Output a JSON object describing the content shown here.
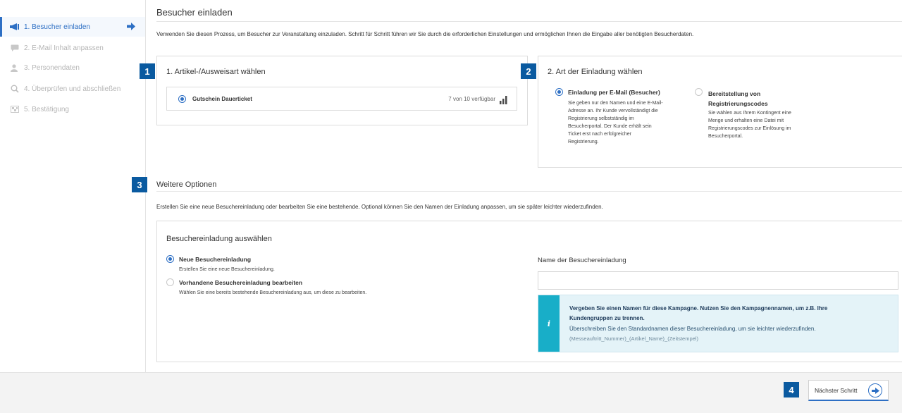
{
  "sidebar": {
    "items": [
      {
        "label": "1. Besucher einladen",
        "icon": "megaphone-icon",
        "active": true
      },
      {
        "label": "2. E-Mail Inhalt anpassen",
        "icon": "message-icon",
        "active": false
      },
      {
        "label": "3. Personendaten",
        "icon": "person-icon",
        "active": false
      },
      {
        "label": "4. Überprüfen und abschließen",
        "icon": "search-icon",
        "active": false
      },
      {
        "label": "5. Bestätigung",
        "icon": "flag-icon",
        "active": false
      }
    ]
  },
  "page": {
    "title": "Besucher einladen",
    "intro": "Verwenden Sie diesen Prozess, um Besucher zur Veranstaltung einzuladen. Schritt für Schritt führen wir Sie durch die erforderlichen Einstellungen und ermöglichen Ihnen die Eingabe aller benötigten Besucherdaten."
  },
  "step1": {
    "badge": "1",
    "title": "1. Artikel-/Ausweisart wählen",
    "article": {
      "label": "Gutschein Dauerticket",
      "availability": "7 von 10 verfügbar",
      "selected": true
    }
  },
  "step2": {
    "badge": "2",
    "title": "2. Art der Einladung wählen",
    "options": [
      {
        "title": "Einladung per E-Mail (Besucher)",
        "desc_lines": [
          "Sie geben nur den Namen und eine E-Mail-",
          "Adresse an. Ihr Kunde vervollständigt die",
          "Registrierung selbstständig im",
          "Besucherportal. Der Kunde erhält sein",
          "Ticket erst nach erfolgreicher",
          "Registrierung."
        ],
        "selected": true
      },
      {
        "title_lines": [
          "Bereitstellung von",
          "Registrierungscodes"
        ],
        "desc_lines": [
          "Sie wählen aus Ihrem Kontingent eine",
          "Menge und erhalten eine Datei mit",
          "Registrierungscodes zur Einlösung im",
          "Besucherportal."
        ],
        "selected": false
      }
    ]
  },
  "step3": {
    "badge": "3",
    "title": "Weitere Optionen",
    "desc": "Erstellen Sie eine neue Besuchereinladung oder bearbeiten Sie eine bestehende. Optional können Sie den Namen der Einladung anpassen, um sie später leichter wiederzufinden.",
    "panel_title": "Besuchereinladung auswählen",
    "options": [
      {
        "title": "Neue Besuchereinladung",
        "desc": "Erstellen Sie eine neue Besuchereinladung.",
        "selected": true
      },
      {
        "title": "Vorhandene Besuchereinladung bearbeiten",
        "desc": "Wählen Sie eine bereits bestehende Besuchereinladung aus, um diese zu bearbeiten.",
        "selected": false
      }
    ],
    "name_label": "Name der Besuchereinladung",
    "name_value": "",
    "info": {
      "bold_text": "Vergeben Sie einen Namen für diese Kampagne. Nutzen Sie den Kampagnennamen, um z.B. Ihre Kundengruppen zu trennen.",
      "text": "Überschreiben Sie den Standardnamen dieser Besuchereinladung, um sie leichter wiederzufinden.",
      "template": "(Messeauftritt_Nummer)_(Artikel_Name)_(Zeitstempel)"
    }
  },
  "footer": {
    "badge": "4",
    "next_label": "Nächster Schritt"
  },
  "colors": {
    "accent": "#2d6fc4",
    "badge": "#0a5aa0",
    "info_strip": "#18aec8",
    "info_bg": "#e4f3f8"
  }
}
